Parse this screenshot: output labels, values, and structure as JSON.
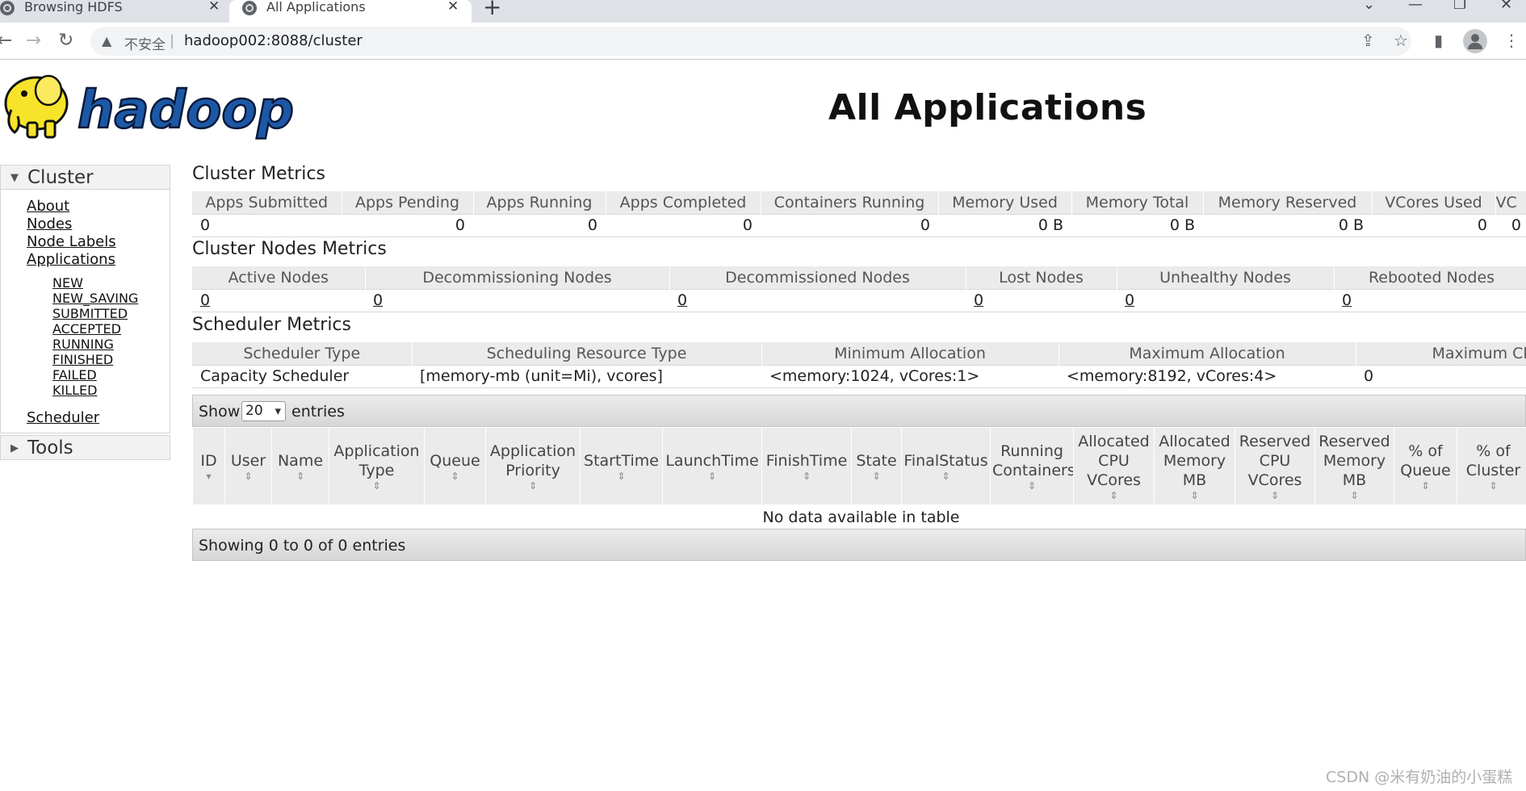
{
  "browser": {
    "tabs": [
      {
        "label": "Browsing HDFS",
        "active": false
      },
      {
        "label": "All Applications",
        "active": true
      }
    ],
    "address_security": "不安全",
    "address_url": "hadoop002:8088/cluster"
  },
  "header": {
    "logo_text": "hadoop",
    "title": "All Applications"
  },
  "sidebar": {
    "cluster_label": "Cluster",
    "links": [
      "About",
      "Nodes",
      "Node Labels",
      "Applications"
    ],
    "app_states": [
      "NEW",
      "NEW_SAVING",
      "SUBMITTED",
      "ACCEPTED",
      "RUNNING",
      "FINISHED",
      "FAILED",
      "KILLED"
    ],
    "scheduler_label": "Scheduler",
    "tools_label": "Tools"
  },
  "cluster_metrics": {
    "title": "Cluster Metrics",
    "headers": [
      "Apps Submitted",
      "Apps Pending",
      "Apps Running",
      "Apps Completed",
      "Containers Running",
      "Memory Used",
      "Memory Total",
      "Memory Reserved",
      "VCores Used",
      "VC"
    ],
    "values": [
      "0",
      "0",
      "0",
      "0",
      "0",
      "0 B",
      "0 B",
      "0 B",
      "0",
      "0"
    ]
  },
  "cluster_nodes_metrics": {
    "title": "Cluster Nodes Metrics",
    "headers": [
      "Active Nodes",
      "Decommissioning Nodes",
      "Decommissioned Nodes",
      "Lost Nodes",
      "Unhealthy Nodes",
      "Rebooted Nodes"
    ],
    "values": [
      "0",
      "0",
      "0",
      "0",
      "0",
      "0"
    ]
  },
  "scheduler_metrics": {
    "title": "Scheduler Metrics",
    "headers": [
      "Scheduler Type",
      "Scheduling Resource Type",
      "Minimum Allocation",
      "Maximum Allocation",
      "Maximum Clu"
    ],
    "values": [
      "Capacity Scheduler",
      "[memory-mb (unit=Mi), vcores]",
      "<memory:1024, vCores:1>",
      "<memory:8192, vCores:4>",
      "0"
    ]
  },
  "apps_table": {
    "show_label": "Show",
    "page_size": "20",
    "entries_label": "entries",
    "headers": [
      "ID",
      "User",
      "Name",
      "Application Type",
      "Queue",
      "Application Priority",
      "StartTime",
      "LaunchTime",
      "FinishTime",
      "State",
      "FinalStatus",
      "Running Containers",
      "Allocated CPU VCores",
      "Allocated Memory MB",
      "Reserved CPU VCores",
      "Reserved Memory MB",
      "% of Queue",
      "% of Cluster"
    ],
    "empty_message": "No data available in table",
    "info": "Showing 0 to 0 of 0 entries"
  },
  "watermark": "CSDN @米有奶油的小蛋糕"
}
